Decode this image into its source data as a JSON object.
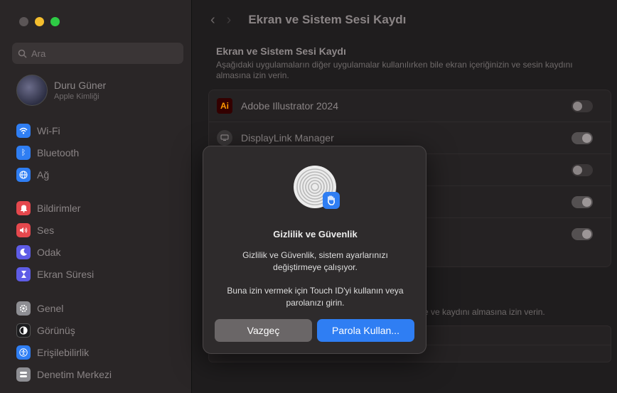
{
  "window": {
    "title": "Ekran ve Sistem Sesi Kaydı"
  },
  "sidebar": {
    "search_placeholder": "Ara",
    "account": {
      "name": "Duru Güner",
      "subtitle": "Apple Kimliği"
    },
    "group1": [
      {
        "label": "Wi-Fi",
        "icon": "wifi-icon",
        "color": "#2f7ef3"
      },
      {
        "label": "Bluetooth",
        "icon": "bluetooth-icon",
        "color": "#2f7ef3"
      },
      {
        "label": "Ağ",
        "icon": "globe-icon",
        "color": "#2f7ef3"
      }
    ],
    "group2": [
      {
        "label": "Bildirimler",
        "icon": "bell-icon",
        "color": "#e5484d"
      },
      {
        "label": "Ses",
        "icon": "speaker-icon",
        "color": "#e5484d"
      },
      {
        "label": "Odak",
        "icon": "moon-icon",
        "color": "#5e5ce6"
      },
      {
        "label": "Ekran Süresi",
        "icon": "hourglass-icon",
        "color": "#5e5ce6"
      }
    ],
    "group3": [
      {
        "label": "Genel",
        "icon": "gear-icon",
        "color": "#8e8e93"
      },
      {
        "label": "Görünüş",
        "icon": "appearance-icon",
        "color": "#1c1c1e"
      },
      {
        "label": "Erişilebilirlik",
        "icon": "accessibility-icon",
        "color": "#2f7ef3"
      },
      {
        "label": "Denetim Merkezi",
        "icon": "control-center-icon",
        "color": "#8e8e93"
      }
    ]
  },
  "main": {
    "section_title": "Ekran ve Sistem Sesi Kaydı",
    "section_desc": "Aşağıdaki uygulamaların diğer uygulamalar kullanılırken bile ekran içeriğinizin ve sesin kaydını almasına izin verin.",
    "apps": [
      {
        "name": "Adobe Illustrator 2024",
        "on": false
      },
      {
        "name": "DisplayLink Manager",
        "on": true
      },
      {
        "name": "",
        "on": false
      },
      {
        "name": "",
        "on": true
      },
      {
        "name": "",
        "on": true
      }
    ],
    "bottom_desc": "e ve kaydını almasına izin verin."
  },
  "dialog": {
    "title": "Gizlilik ve Güvenlik",
    "message1": "Gizlilik ve Güvenlik, sistem ayarlarınızı değiştirmeye çalışıyor.",
    "message2": "Buna izin vermek için Touch ID'yi kullanın veya parolanızı girin.",
    "cancel_label": "Vazgeç",
    "primary_label": "Parola Kullan...",
    "accent": "#2f7ef3"
  }
}
